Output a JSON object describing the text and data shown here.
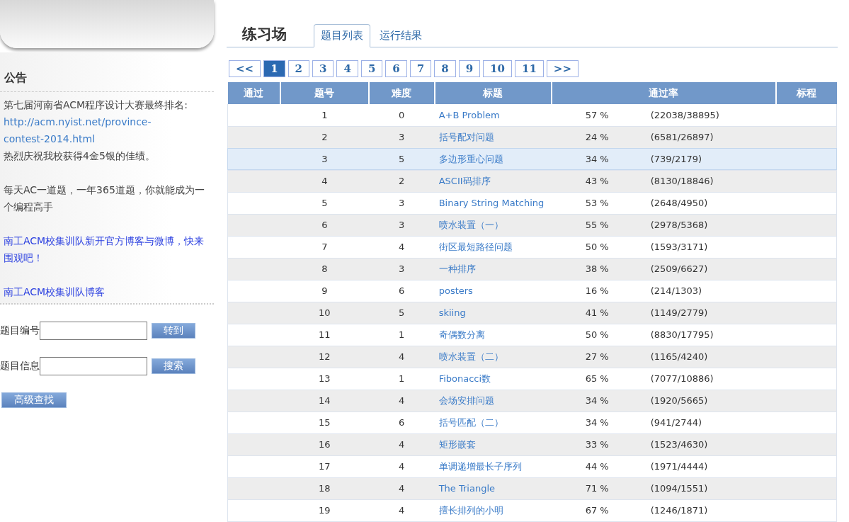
{
  "notice": {
    "title": "公告",
    "paragraphs": [
      {
        "kind": "text_with_link",
        "text": "第七届河南省ACM程序设计大赛最终排名:",
        "link": "http://acm.nyist.net/province-contest-2014.html",
        "after": "热烈庆祝我校获得4金5银的佳绩。"
      },
      {
        "kind": "text",
        "text": "每天AC一道题，一年365道题，你就能成为一个编程高手"
      },
      {
        "kind": "link",
        "text": "南工ACM校集训队新开官方博客与微博，快来围观吧！"
      },
      {
        "kind": "link",
        "text": "南工ACM校集训队博客"
      }
    ]
  },
  "search": [
    {
      "label": "题目编号",
      "button": "转到"
    },
    {
      "label": "题目信息",
      "button": "搜索"
    }
  ],
  "advanced_button": "高级查找",
  "page_title": "练习场",
  "tabs": [
    {
      "label": "题目列表",
      "selected": true
    },
    {
      "label": "运行结果",
      "selected": false
    }
  ],
  "pagination": [
    {
      "label": "<<",
      "selected": false
    },
    {
      "label": "1",
      "selected": true
    },
    {
      "label": "2",
      "selected": false
    },
    {
      "label": "3",
      "selected": false
    },
    {
      "label": "4",
      "selected": false
    },
    {
      "label": "5",
      "selected": false
    },
    {
      "label": "6",
      "selected": false
    },
    {
      "label": "7",
      "selected": false
    },
    {
      "label": "8",
      "selected": false
    },
    {
      "label": "9",
      "selected": false
    },
    {
      "label": "10",
      "selected": false
    },
    {
      "label": "11",
      "selected": false
    },
    {
      "label": ">>",
      "selected": false
    }
  ],
  "table": {
    "columns": [
      "通过",
      "题号",
      "难度",
      "标题",
      "通过率",
      "标程"
    ],
    "rows": [
      {
        "id": "1",
        "difficulty": "0",
        "title": "A+B Problem",
        "rate": "57 %",
        "counts": "(22038/38895)",
        "highlighted": false
      },
      {
        "id": "2",
        "difficulty": "3",
        "title": "括号配对问题",
        "rate": "24 %",
        "counts": "(6581/26897)",
        "highlighted": false
      },
      {
        "id": "3",
        "difficulty": "5",
        "title": "多边形重心问题",
        "rate": "34 %",
        "counts": "(739/2179)",
        "highlighted": true
      },
      {
        "id": "4",
        "difficulty": "2",
        "title": "ASCII码排序",
        "rate": "43 %",
        "counts": "(8130/18846)",
        "highlighted": false
      },
      {
        "id": "5",
        "difficulty": "3",
        "title": "Binary String Matching",
        "rate": "53 %",
        "counts": "(2648/4950)",
        "highlighted": false
      },
      {
        "id": "6",
        "difficulty": "3",
        "title": "喷水装置（一）",
        "rate": "55 %",
        "counts": "(2978/5368)",
        "highlighted": false
      },
      {
        "id": "7",
        "difficulty": "4",
        "title": "街区最短路径问题",
        "rate": "50 %",
        "counts": "(1593/3171)",
        "highlighted": false
      },
      {
        "id": "8",
        "difficulty": "3",
        "title": "一种排序",
        "rate": "38 %",
        "counts": "(2509/6627)",
        "highlighted": false
      },
      {
        "id": "9",
        "difficulty": "6",
        "title": "posters",
        "rate": "16 %",
        "counts": "(214/1303)",
        "highlighted": false
      },
      {
        "id": "10",
        "difficulty": "5",
        "title": "skiing",
        "rate": "41 %",
        "counts": "(1149/2779)",
        "highlighted": false
      },
      {
        "id": "11",
        "difficulty": "1",
        "title": "奇偶数分离",
        "rate": "50 %",
        "counts": "(8830/17795)",
        "highlighted": false
      },
      {
        "id": "12",
        "difficulty": "4",
        "title": "喷水装置（二）",
        "rate": "27 %",
        "counts": "(1165/4240)",
        "highlighted": false
      },
      {
        "id": "13",
        "difficulty": "1",
        "title": "Fibonacci数",
        "rate": "65 %",
        "counts": "(7077/10886)",
        "highlighted": false
      },
      {
        "id": "14",
        "difficulty": "4",
        "title": "会场安排问题",
        "rate": "34 %",
        "counts": "(1920/5665)",
        "highlighted": false
      },
      {
        "id": "15",
        "difficulty": "6",
        "title": "括号匹配（二）",
        "rate": "34 %",
        "counts": "(941/2744)",
        "highlighted": false
      },
      {
        "id": "16",
        "difficulty": "4",
        "title": "矩形嵌套",
        "rate": "33 %",
        "counts": "(1523/4630)",
        "highlighted": false
      },
      {
        "id": "17",
        "difficulty": "4",
        "title": "单调递增最长子序列",
        "rate": "44 %",
        "counts": "(1971/4444)",
        "highlighted": false
      },
      {
        "id": "18",
        "difficulty": "4",
        "title": "The Triangle",
        "rate": "71 %",
        "counts": "(1094/1551)",
        "highlighted": false
      },
      {
        "id": "19",
        "difficulty": "4",
        "title": "擅长排列的小明",
        "rate": "67 %",
        "counts": "(1246/1871)",
        "highlighted": false
      }
    ]
  }
}
